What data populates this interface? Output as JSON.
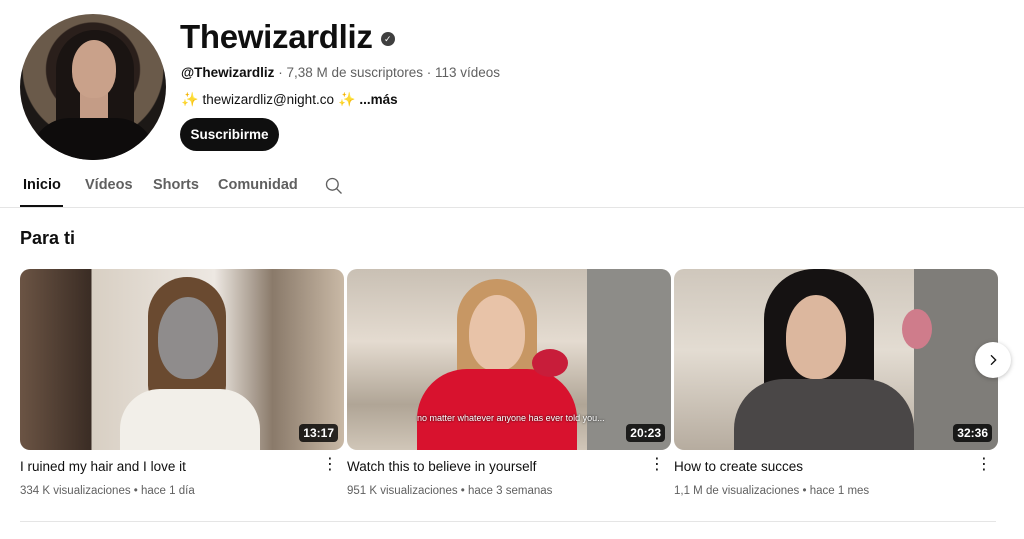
{
  "channel": {
    "name": "Thewizardliz",
    "verified_icon": "check-circle-icon",
    "handle": "@Thewizardliz",
    "subscribers": "7,38 M de suscriptores",
    "videos_count": "113 vídeos",
    "separator": " · ",
    "description_link": "thewizardliz@night.co",
    "description_more": "...más",
    "subscribe_label": "Suscribirme"
  },
  "tabs": [
    {
      "label": "Inicio"
    },
    {
      "label": "Vídeos"
    },
    {
      "label": "Shorts"
    },
    {
      "label": "Comunidad"
    }
  ],
  "section": {
    "title": "Para ti"
  },
  "videos": [
    {
      "title": "I ruined my hair and I love it",
      "duration": "13:17",
      "views": "334 K visualizaciones",
      "age": "hace 1 día"
    },
    {
      "title": "Watch this to believe in yourself",
      "duration": "20:23",
      "views": "951 K visualizaciones",
      "age": "hace 3 semanas",
      "caption": "no matter whatever anyone has ever told you..."
    },
    {
      "title": "How to create succes",
      "duration": "32:36",
      "views": "1,1 M de visualizaciones",
      "age": "hace 1 mes"
    }
  ],
  "colors": {
    "primary_text": "#0f0f0f",
    "secondary_text": "#606060",
    "subscribe_bg": "#0f0f0f"
  }
}
